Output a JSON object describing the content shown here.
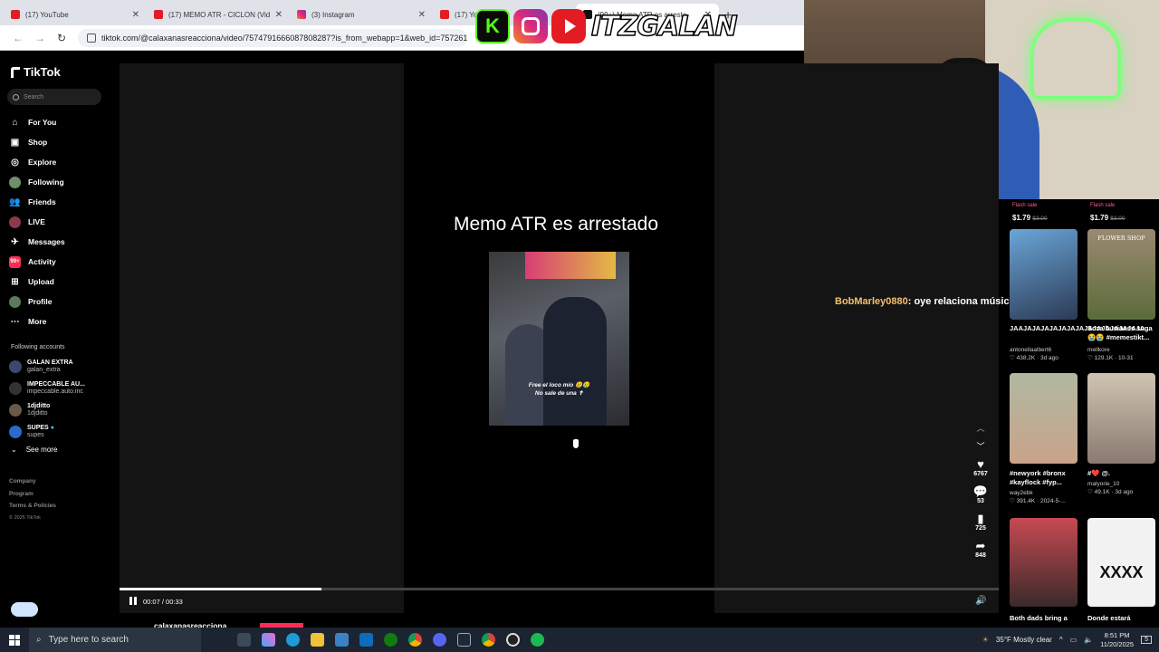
{
  "browser": {
    "tabs": [
      {
        "title": "(17) YouTube",
        "favicon": "youtube"
      },
      {
        "title": "(17) MEMO ATR - CICLON (Vid",
        "favicon": "youtube"
      },
      {
        "title": "(3) Instagram",
        "favicon": "instagram"
      },
      {
        "title": "(17) YouTube",
        "favicon": "youtube"
      },
      {
        "title": "(99+) Memo ATR es arresta",
        "favicon": "tiktok"
      }
    ],
    "new_tab": "+",
    "url": "tiktok.com/@calaxanasreacciona/video/7574791666087808287?is_from_webapp=1&web_id=7572612"
  },
  "overlay": {
    "logos": [
      "kick",
      "instagram",
      "youtube"
    ],
    "kick_letter": "K",
    "brand": "ITZGALAN"
  },
  "tiktok": {
    "logo": "TikTok",
    "search_placeholder": "Search",
    "nav": [
      {
        "label": "For You",
        "icon": "home-icon"
      },
      {
        "label": "Shop",
        "icon": "shop-icon"
      },
      {
        "label": "Explore",
        "icon": "compass-icon"
      },
      {
        "label": "Following",
        "icon": "avatar"
      },
      {
        "label": "Friends",
        "icon": "friends-icon"
      },
      {
        "label": "LIVE",
        "icon": "avatar"
      },
      {
        "label": "Messages",
        "icon": "message-icon"
      },
      {
        "label": "Activity",
        "icon": "activity-icon"
      },
      {
        "label": "Upload",
        "icon": "upload-icon"
      },
      {
        "label": "Profile",
        "icon": "avatar"
      },
      {
        "label": "More",
        "icon": "more-icon"
      }
    ],
    "following_title": "Following accounts",
    "accounts": [
      {
        "name": "GALAN EXTRA",
        "handle": "galan_extra"
      },
      {
        "name": "IMPECCABLE AU...",
        "handle": "impeccable.auto.inc"
      },
      {
        "name": "1djditto",
        "handle": "1djditto"
      },
      {
        "name": "SUPES",
        "handle": "supes"
      }
    ],
    "see_more": "See more",
    "footer": [
      "Company",
      "Program",
      "Terms & Policies"
    ],
    "copyright": "© 2025 TikTok"
  },
  "video": {
    "title": "Memo ATR es arrestado",
    "caption_line1": "Free el loco mío 😢😢",
    "caption_line2": "No sale de una ✝",
    "time": "00:07 / 00:33",
    "progress": 0.23,
    "author": "calaxanasreacciona"
  },
  "actions": [
    {
      "icon": "heart-icon",
      "count": "6767"
    },
    {
      "icon": "comment-icon",
      "count": "53"
    },
    {
      "icon": "bookmark-icon",
      "count": "725"
    },
    {
      "icon": "share-icon",
      "count": "848"
    }
  ],
  "chat": {
    "user": "BobMarley0880",
    "message": ": oye relaciona música"
  },
  "shop": {
    "flash_label": "Flash sale",
    "price": "$1.79",
    "old_price": "$3.00"
  },
  "grid": [
    {
      "title": "JAAJAJAJAJAJAJAJAJAJAJAJAJAJAJA...",
      "user": "antonellaalbert6",
      "meta": "♡ 438.2K · 3d ago"
    },
    {
      "title": "Soza business suga 😭😭 #memestikt...",
      "user": "mellkore",
      "meta": "♡ 129.1K · 10-31"
    },
    {
      "title": "#newyork #bronx #kayflock #fyp...",
      "user": "way2ebk",
      "meta": "♡ 391.4K · 2024-5-..."
    },
    {
      "title": "#❤️ @.",
      "user": "malyorie_10",
      "meta": "♡ 49.1K · 3d ago"
    },
    {
      "title": "Both dads bring a",
      "user": "",
      "meta": ""
    },
    {
      "title": "Donde estará",
      "user": "",
      "meta": ""
    }
  ],
  "grid_thumb_texts": {
    "flower_shop": "FLOWER SHOP",
    "xxxx": "XXXX"
  },
  "taskbar": {
    "search_placeholder": "Type here to search",
    "weather": "35°F  Mostly clear",
    "time": "8:51 PM",
    "date": "11/20/2025",
    "notifications": "5"
  }
}
